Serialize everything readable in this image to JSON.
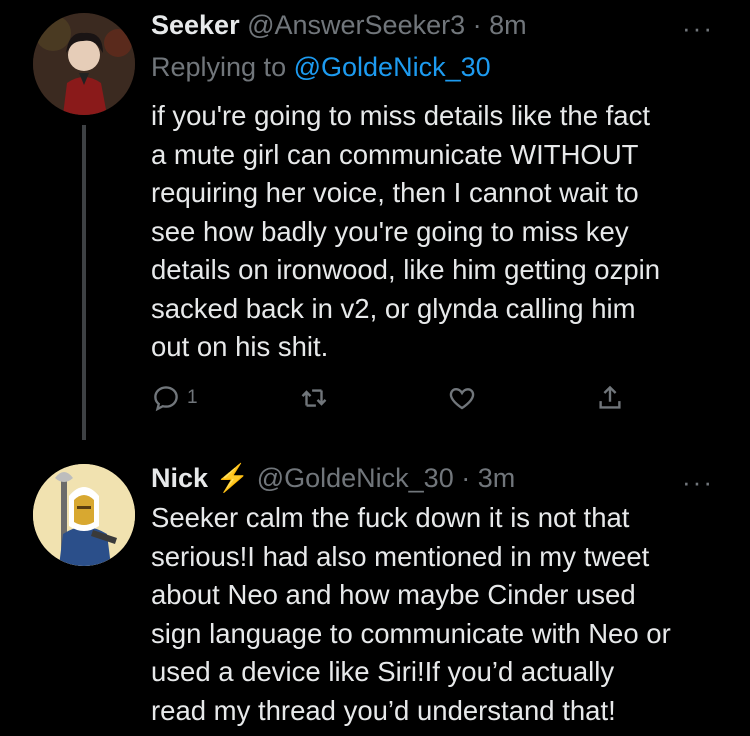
{
  "tweet1": {
    "name": "Seeker",
    "handle": "@AnswerSeeker3",
    "separator": "·",
    "time": "8m",
    "replying_label": "Replying to",
    "replying_handle": "@GoldeNick_30",
    "text": "if you're going to miss details like the fact\na mute girl can communicate WITHOUT\nrequiring her voice, then I cannot wait to\nsee how badly you're going to miss key\ndetails on ironwood, like him getting ozpin\nsacked back in v2, or glynda calling him\nout on his shit.",
    "reply_count": "1",
    "more": "···"
  },
  "tweet2": {
    "name": "Nick",
    "name_emoji": "⚡",
    "handle": "@GoldeNick_30",
    "separator": "·",
    "time": "3m",
    "text": "Seeker calm the fuck down it is not that\nserious!I had also mentioned in my tweet\nabout Neo and how maybe Cinder used\nsign language to communicate with Neo or\nused a device like Siri!If you’d actually\nread my thread you’d understand that!",
    "more": "···"
  },
  "colors": {
    "background": "#000000",
    "text": "#e7e9ea",
    "secondary": "#71767b",
    "link": "#1d9bf0",
    "lightning": "#f5a623"
  },
  "icons": [
    "reply-icon",
    "retweet-icon",
    "like-icon",
    "share-icon",
    "more-icon",
    "lightning-icon"
  ]
}
